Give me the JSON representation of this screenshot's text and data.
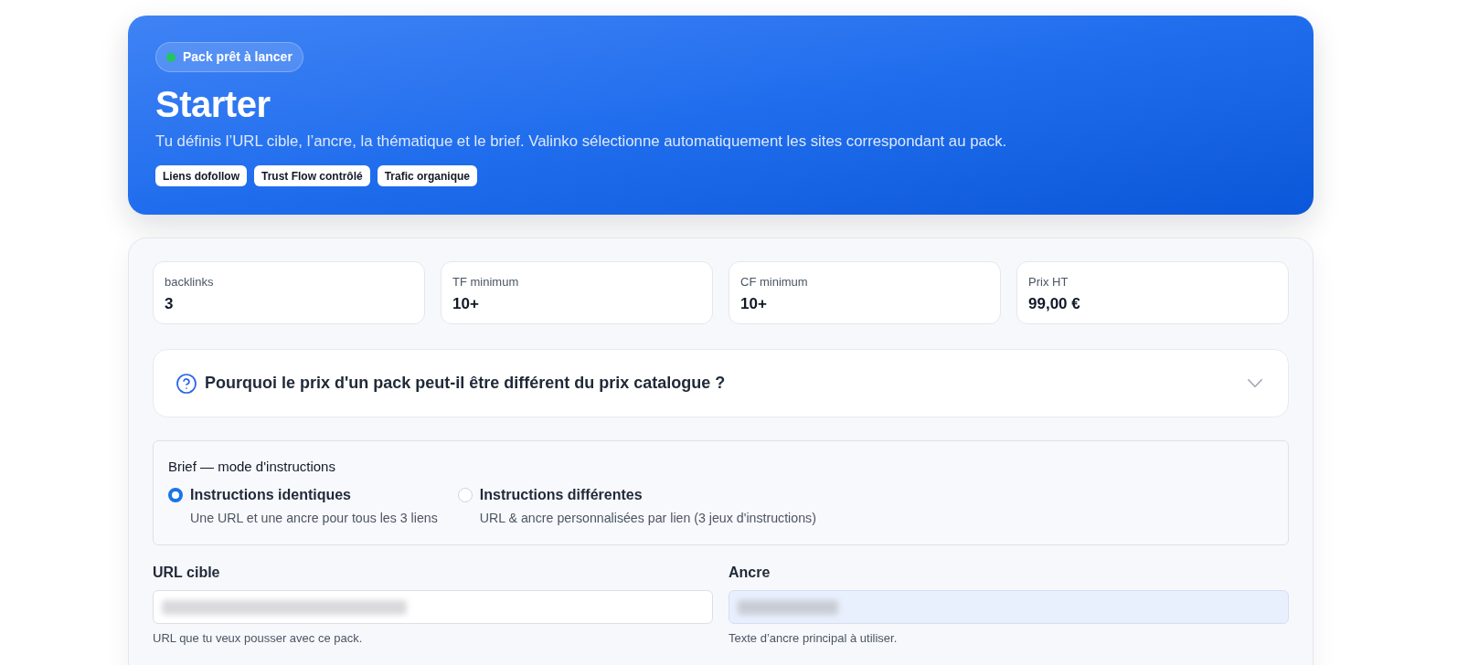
{
  "hero": {
    "status_badge": {
      "label": "Pack prêt à lancer",
      "active": true
    },
    "title": "Starter",
    "description": "Tu définis l’URL cible, l’ancre, la thématique et le brief. Valinko sélectionne automatiquement les sites correspondant au pack.",
    "tags": [
      "Liens dofollow",
      "Trust Flow contrôlé",
      "Trafic organique"
    ]
  },
  "stats": [
    {
      "label": "backlinks",
      "value": "3"
    },
    {
      "label": "TF minimum",
      "value": "10+"
    },
    {
      "label": "CF minimum",
      "value": "10+"
    },
    {
      "label": "Prix HT",
      "value": "99,00 €"
    }
  ],
  "faq": {
    "question": "Pourquoi le prix d'un pack peut-il être différent du prix catalogue ?",
    "expanded": false
  },
  "brief": {
    "title": "Brief — mode d'instructions",
    "options": [
      {
        "label": "Instructions identiques",
        "description": "Une URL et une ancre pour tous les 3 liens",
        "selected": true
      },
      {
        "label": "Instructions différentes",
        "description": "URL & ancre personnalisées par lien (3 jeux d'instructions)",
        "selected": false
      }
    ]
  },
  "fields": [
    {
      "label": "URL cible",
      "help": "URL que tu veux pousser avec ce pack.",
      "autofilled": false,
      "redacted": true
    },
    {
      "label": "Ancre",
      "help": "Texte d’ancre principal à utiliser.",
      "autofilled": true,
      "redacted": true
    }
  ]
}
